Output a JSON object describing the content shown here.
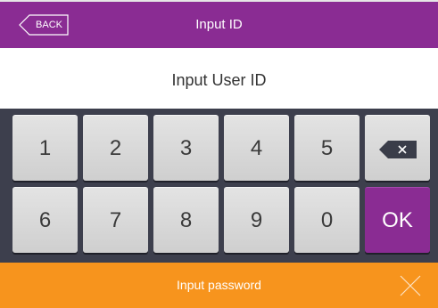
{
  "header": {
    "back_label": "BACK",
    "title": "Input ID"
  },
  "prompt": {
    "text": "Input User ID"
  },
  "keypad": {
    "row1": [
      "1",
      "2",
      "3",
      "4",
      "5"
    ],
    "row2": [
      "6",
      "7",
      "8",
      "9",
      "0"
    ],
    "ok_label": "OK",
    "backspace_icon": "backspace-icon"
  },
  "footer": {
    "label": "Input password",
    "close_icon": "close-icon"
  },
  "colors": {
    "accent": "#8a2c93",
    "keypad_bg": "#3d3f4d",
    "footer": "#f7941d",
    "key": "#d9d9d9"
  }
}
